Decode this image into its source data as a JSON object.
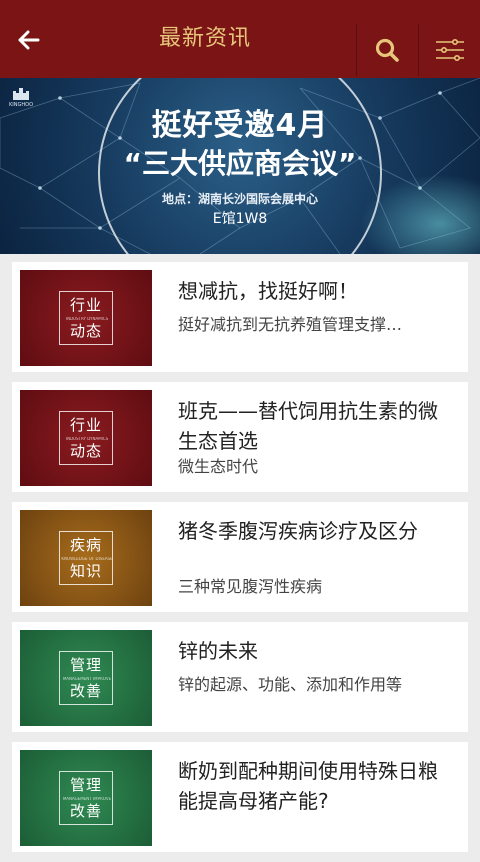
{
  "header": {
    "title": "最新资讯",
    "colors": {
      "bar": "#7b1414",
      "title": "#e7c67b"
    },
    "icons": [
      "arrow-left-icon",
      "search-icon",
      "filter-menu-icon"
    ]
  },
  "banner": {
    "logo_text": "KINGHOO",
    "line1": "挺好受邀4月",
    "line2": "“三大供应商会议”",
    "line3": "地点：湖南长沙国际会展中心",
    "line4": "E馆1W8"
  },
  "articles": [
    {
      "tag_top": "行业",
      "tag_bottom": "动态",
      "tag_en": "INDUSTRY DYNAMICS",
      "title": "想减抗，找挺好啊！",
      "subtitle": "挺好减抗到无抗养殖管理支撑…",
      "color": "#7a1519"
    },
    {
      "tag_top": "行业",
      "tag_bottom": "动态",
      "tag_en": "INDUSTRY DYNAMICS",
      "title": "班克——替代饲用抗生素的微生态首选",
      "subtitle": "微生态时代",
      "color": "#7a1519"
    },
    {
      "tag_top": "疾病",
      "tag_bottom": "知识",
      "tag_en": "KNOWLEDGE OF DISEASE",
      "title": "猪冬季腹泻疾病诊疗及区分",
      "subtitle": "三种常见腹泻性疾病",
      "color": "#8e5a17"
    },
    {
      "tag_top": "管理",
      "tag_bottom": "改善",
      "tag_en": "MANAGEMENT IMPROVE",
      "title": "锌的未来",
      "subtitle": "锌的起源、功能、添加和作用等",
      "color": "#24734a"
    },
    {
      "tag_top": "管理",
      "tag_bottom": "改善",
      "tag_en": "MANAGEMENT IMPROVE",
      "title": "断奶到配种期间使用特殊日粮能提高母猪产能?",
      "subtitle": "",
      "color": "#24734a"
    }
  ]
}
